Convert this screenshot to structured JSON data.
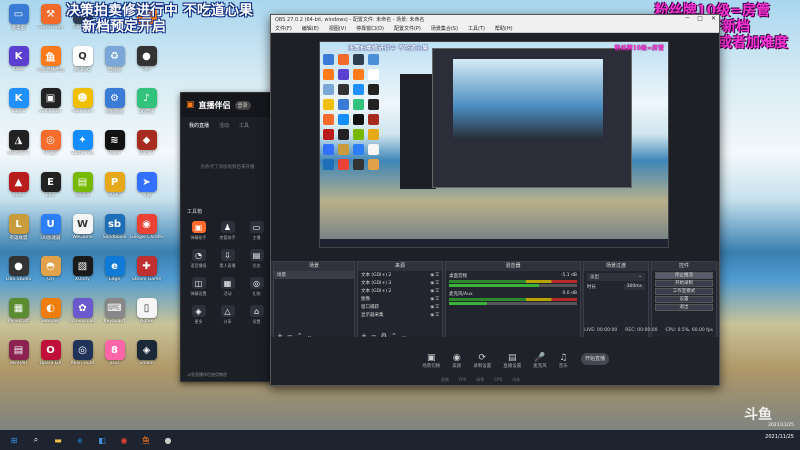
{
  "overlays": {
    "left_line1": "决策拍卖修进行中 不吃道心果",
    "left_line2": "新档预定开启",
    "right_line1": "粉丝牌10级=房管",
    "right_line2": "飞机=立即开新档",
    "right_line3": "或者加难度"
  },
  "desktop_icons": [
    {
      "label": "此电脑",
      "color": "#3a7bd5",
      "glyph": "▭"
    },
    {
      "label": "CurseForge",
      "color": "#f26b2a",
      "glyph": "⚒"
    },
    {
      "label": "Genshin",
      "color": "#2c3e50",
      "glyph": "G"
    },
    {
      "label": "网络",
      "color": "#4a90d9",
      "glyph": "◈"
    },
    {
      "label": "DouyuLive",
      "color": "#ff7a1a",
      "glyph": "鱼"
    },
    {
      "label": "Kook",
      "color": "#5a3fd0",
      "glyph": "K"
    },
    {
      "label": "斗鱼直播伴侣",
      "color": "#ff7a1a",
      "glyph": "鱼"
    },
    {
      "label": "腾讯QQ",
      "color": "#ffffff",
      "glyph": "Q"
    },
    {
      "label": "回收站",
      "color": "#7aa7d8",
      "glyph": "♻"
    },
    {
      "label": "Obs",
      "color": "#333333",
      "glyph": "●"
    },
    {
      "label": "Kugou",
      "color": "#1e90ff",
      "glyph": "K"
    },
    {
      "label": "Wallpaper",
      "color": "#222222",
      "glyph": "▣"
    },
    {
      "label": "Yuanshen",
      "color": "#f0c000",
      "glyph": "☻"
    },
    {
      "label": "控制面板",
      "color": "#3a7bd5",
      "glyph": "⚙"
    },
    {
      "label": "QQ音乐",
      "color": "#31c27c",
      "glyph": "♪"
    },
    {
      "label": "Destiny 2",
      "color": "#222",
      "glyph": "◮"
    },
    {
      "label": "Origin",
      "color": "#f56c2d",
      "glyph": "◎"
    },
    {
      "label": "Battle.net",
      "color": "#148eff",
      "glyph": "✦"
    },
    {
      "label": "Razer",
      "color": "#111",
      "glyph": "≋"
    },
    {
      "label": "Dota 2",
      "color": "#a82b1f",
      "glyph": "◆"
    },
    {
      "label": "Apex",
      "color": "#b81c1c",
      "glyph": "▲"
    },
    {
      "label": "Epic",
      "color": "#222",
      "glyph": "E"
    },
    {
      "label": "Nvidia",
      "color": "#76b900",
      "glyph": "▤"
    },
    {
      "label": "PUBG",
      "color": "#e5a91a",
      "glyph": "P"
    },
    {
      "label": "飞书",
      "color": "#3370ff",
      "glyph": "➤"
    },
    {
      "label": "英雄联盟",
      "color": "#c89b3c",
      "glyph": "L"
    },
    {
      "label": "UU加速器",
      "color": "#2d7ff9",
      "glyph": "U"
    },
    {
      "label": "WeGame",
      "color": "#f5f5f5",
      "glyph": "W"
    },
    {
      "label": "Sandboxie",
      "color": "#1e6fb8",
      "glyph": "sb"
    },
    {
      "label": "Google Chrome",
      "color": "#ea4335",
      "glyph": "◉"
    },
    {
      "label": "OBS Studio",
      "color": "#333",
      "glyph": "●"
    },
    {
      "label": "Ori",
      "color": "#e2a24a",
      "glyph": "◓"
    },
    {
      "label": "XUnity",
      "color": "#1a1a1a",
      "glyph": "▧"
    },
    {
      "label": "Edge",
      "color": "#0f7bd6",
      "glyph": "e"
    },
    {
      "label": "Steam Game",
      "color": "#c03030",
      "glyph": "✚"
    },
    {
      "label": "Minecraft",
      "color": "#5b8c32",
      "glyph": "▦"
    },
    {
      "label": "Blender",
      "color": "#ef7d0b",
      "glyph": "◐"
    },
    {
      "label": "screencolor",
      "color": "#6a5acd",
      "glyph": "✿"
    },
    {
      "label": "Keyboard",
      "color": "#888",
      "glyph": "⌨"
    },
    {
      "label": "Notes",
      "color": "#f5f5f5",
      "glyph": "▯"
    },
    {
      "label": "WinRAR",
      "color": "#8b2252",
      "glyph": "▤"
    },
    {
      "label": "Opera GX",
      "color": "#c0103a",
      "glyph": "O"
    },
    {
      "label": "Alien Hunt",
      "color": "#22335a",
      "glyph": "◎"
    },
    {
      "label": "osu!",
      "color": "#ff66aa",
      "glyph": "8"
    },
    {
      "label": "Steam",
      "color": "#1b2838",
      "glyph": "◈"
    }
  ],
  "taskbar": {
    "items": [
      {
        "name": "start-icon",
        "glyph": "⊞",
        "color": "#3a8ee6"
      },
      {
        "name": "search-icon",
        "glyph": "⌕",
        "color": "#ffffff"
      },
      {
        "name": "file-explorer-icon",
        "glyph": "▬",
        "color": "#f2c34a"
      },
      {
        "name": "edge-icon",
        "glyph": "e",
        "color": "#1f8ad8"
      },
      {
        "name": "store-icon",
        "glyph": "◧",
        "color": "#4a90d9"
      },
      {
        "name": "chrome-icon",
        "glyph": "◉",
        "color": "#ea4335"
      },
      {
        "name": "douyu-icon",
        "glyph": "鱼",
        "color": "#ff7a1a"
      },
      {
        "name": "obs-icon",
        "glyph": "●",
        "color": "#cccccc"
      }
    ],
    "date": "2021/11/25"
  },
  "companion": {
    "title": "直播伴侣",
    "pill": "登录",
    "tabs": [
      "我的直播",
      "活动",
      "工具"
    ],
    "tip": "先你点了添加视频后来开播",
    "tools_title": "工具箱",
    "tools": [
      {
        "label": "弹幕助手",
        "glyph": "▣",
        "hl": true
      },
      {
        "label": "房管助手",
        "glyph": "♟",
        "hl": false
      },
      {
        "label": "主播",
        "glyph": "▭",
        "hl": false
      },
      {
        "label": "语音播报",
        "glyph": "◔",
        "hl": false
      },
      {
        "label": "素人直播",
        "glyph": "⇩",
        "hl": false
      },
      {
        "label": "任务",
        "glyph": "▤",
        "hl": false
      },
      {
        "label": "弹幕设置",
        "glyph": "◫",
        "hl": false
      },
      {
        "label": "活动",
        "glyph": "▦",
        "hl": false
      },
      {
        "label": "礼物",
        "glyph": "◎",
        "hl": false
      },
      {
        "label": "更多",
        "glyph": "◈",
        "hl": false
      },
      {
        "label": "分享",
        "glyph": "△",
        "hl": false
      },
      {
        "label": "设置",
        "glyph": "⌂",
        "hl": false
      }
    ],
    "footer": "斗鱼直播伴侣使用教程"
  },
  "obs": {
    "title": "OBS 27.0.2 (64-bit, windows) - 配置文件: 未命名 - 场景: 未命名",
    "menu": [
      "文件(F)",
      "编辑(E)",
      "视图(V)",
      "停靠窗口(D)",
      "配置文件(P)",
      "场景集合(S)",
      "工具(T)",
      "帮助(H)"
    ],
    "docks": {
      "scenes": {
        "title": "场景",
        "items": [
          "场景"
        ]
      },
      "sources": {
        "title": "来源",
        "items": [
          "文本 (GDI+) 2",
          "文本 (GDI+) 3",
          "文本 (GDI+) 2",
          "图像",
          "窗口捕获",
          "显示器采集"
        ]
      },
      "mixer": {
        "title": "混音器",
        "tracks": [
          {
            "name": "桌面音频",
            "db": "-5.1 dB",
            "fill": 0.7
          },
          {
            "name": "麦克风/Aux",
            "db": "0.0 dB",
            "fill": 0.3
          }
        ]
      },
      "transitions": {
        "title": "场景过渡",
        "type": "淡出",
        "duration_label": "时长",
        "duration": "300ms"
      },
      "controls": {
        "title": "控件",
        "buttons": [
          "停止推流",
          "开始录制",
          "工作室模式",
          "设置",
          "退出"
        ]
      }
    },
    "status": {
      "live": "LIVE: 00:00:00",
      "rec": "REC: 00:00:00",
      "cpu": "CPU: 0.5%, 60.00 fps"
    },
    "bottom_buttons": [
      "场景切换",
      "美颜",
      "录制设置",
      "直播设置",
      "麦克风",
      "音乐"
    ],
    "start_label": "开始直播",
    "bottom_stats": [
      "丢帧",
      "FPS",
      "码率",
      "CPU",
      "内存"
    ]
  },
  "brand": "斗鱼"
}
